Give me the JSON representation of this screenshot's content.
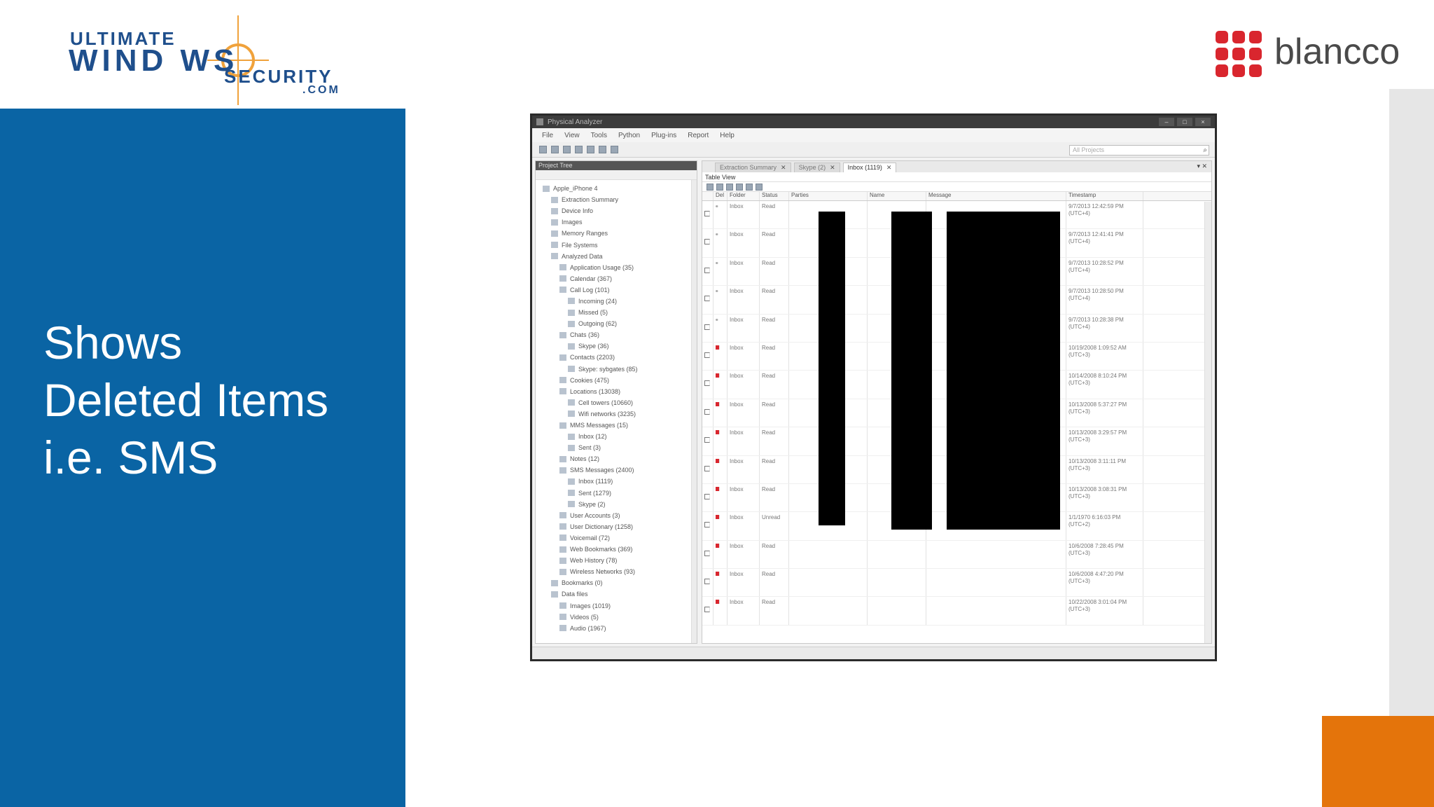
{
  "logos": {
    "uws": {
      "line1": "ULTIMATE",
      "line2": "WIND   WS",
      "line3": "SECURITY",
      "line4": ".COM"
    },
    "blancco": {
      "text": "blancco",
      "dot_color": "#d9262e"
    }
  },
  "slide": {
    "title": "Shows\nDeleted Items\ni.e. SMS",
    "colors": {
      "panel": "#0a64a4",
      "accent": "#e4740b",
      "strip": "#e6e6e6"
    }
  },
  "window": {
    "title": "Physical Analyzer",
    "controls": [
      "–",
      "□",
      "×"
    ],
    "menu": [
      "File",
      "View",
      "Tools",
      "Python",
      "Plug-ins",
      "Report",
      "Help"
    ],
    "search_placeholder": "All Projects",
    "project_tree": {
      "header": "Project Tree",
      "items": [
        "Apple_iPhone 4",
        "Extraction Summary",
        "Device Info",
        "Images",
        "Memory Ranges",
        "File Systems",
        "Analyzed Data",
        "Application Usage (35)",
        "Calendar (367)",
        "Call Log (101)",
        "Incoming (24)",
        "Missed (5)",
        "Outgoing (62)",
        "Chats (36)",
        "Skype (36)",
        "Contacts (2203)",
        "Skype: sybgates (85)",
        "Cookies (475)",
        "Locations (13038)",
        "Cell towers (10660)",
        "Wifi networks (3235)",
        "MMS Messages (15)",
        "Inbox (12)",
        "Sent (3)",
        "Notes (12)",
        "SMS Messages (2400)",
        "Inbox (1119)",
        "Sent (1279)",
        "Skype (2)",
        "User Accounts (3)",
        "User Dictionary (1258)",
        "Voicemail (72)",
        "Web Bookmarks (369)",
        "Web History (78)",
        "Wireless Networks (93)",
        "Bookmarks (0)",
        "Data files",
        "Images (1019)",
        "Videos (5)",
        "Audio (1967)"
      ]
    },
    "tabs": [
      "Extraction Summary",
      "Skype (2)",
      "Inbox (1119)"
    ],
    "table_view_label": "Table View",
    "columns": [
      "",
      "Del",
      "Folder",
      "Status",
      "Parties",
      "Name",
      "Message",
      "Timestamp"
    ],
    "rows": [
      {
        "deleted": false,
        "folder": "Inbox",
        "status": "Read",
        "timestamp": "9/7/2013 12:42:59 PM (UTC+4)"
      },
      {
        "deleted": false,
        "folder": "Inbox",
        "status": "Read",
        "timestamp": "9/7/2013 12:41:41 PM (UTC+4)"
      },
      {
        "deleted": false,
        "folder": "Inbox",
        "status": "Read",
        "timestamp": "9/7/2013 10:28:52 PM (UTC+4)"
      },
      {
        "deleted": false,
        "folder": "Inbox",
        "status": "Read",
        "timestamp": "9/7/2013 10:28:50 PM (UTC+4)"
      },
      {
        "deleted": false,
        "folder": "Inbox",
        "status": "Read",
        "timestamp": "9/7/2013 10:28:38 PM (UTC+4)"
      },
      {
        "deleted": true,
        "folder": "Inbox",
        "status": "Read",
        "timestamp": "10/19/2008 1:09:52 AM (UTC+3)"
      },
      {
        "deleted": true,
        "folder": "Inbox",
        "status": "Read",
        "timestamp": "10/14/2008 8:10:24 PM (UTC+3)"
      },
      {
        "deleted": true,
        "folder": "Inbox",
        "status": "Read",
        "timestamp": "10/13/2008 5:37:27 PM (UTC+3)"
      },
      {
        "deleted": true,
        "folder": "Inbox",
        "status": "Read",
        "timestamp": "10/13/2008 3:29:57 PM (UTC+3)"
      },
      {
        "deleted": true,
        "folder": "Inbox",
        "status": "Read",
        "timestamp": "10/13/2008 3:11:11 PM (UTC+3)"
      },
      {
        "deleted": true,
        "folder": "Inbox",
        "status": "Read",
        "timestamp": "10/13/2008 3:08:31 PM (UTC+3)"
      },
      {
        "deleted": true,
        "folder": "Inbox",
        "status": "Unread",
        "timestamp": "1/1/1970 6:16:03 PM (UTC+2)"
      },
      {
        "deleted": true,
        "folder": "Inbox",
        "status": "Read",
        "timestamp": "10/6/2008 7:28:45 PM (UTC+3)"
      },
      {
        "deleted": true,
        "folder": "Inbox",
        "status": "Read",
        "timestamp": "10/6/2008 4:47:20 PM (UTC+3)"
      },
      {
        "deleted": true,
        "folder": "Inbox",
        "status": "Read",
        "timestamp": "10/22/2008 3:01:04 PM (UTC+3)"
      }
    ]
  }
}
